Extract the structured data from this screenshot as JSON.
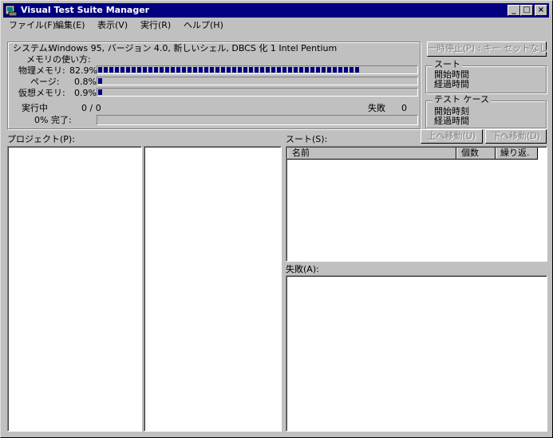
{
  "window": {
    "title": "Visual Test Suite Manager"
  },
  "caption_buttons": {
    "minimize": "_",
    "maximize": "□",
    "close": "×"
  },
  "menu": [
    {
      "label": "ファイル(F)"
    },
    {
      "label": "編集(E)"
    },
    {
      "label": "表示(V)"
    },
    {
      "label": "実行(R)"
    },
    {
      "label": "ヘルプ(H)"
    }
  ],
  "system": {
    "label": "システム:",
    "value": "Windows 95, バージョン 4.0, 新しいシェル, DBCS 化 1 Intel Pentium",
    "memory_label": "メモリの使い方:",
    "physical": {
      "label": "物理メモリ:",
      "value": "82.9%",
      "level": 0.829
    },
    "page": {
      "label": "ページ:",
      "value": "0.8%",
      "level": 0.008
    },
    "virtual": {
      "label": "仮想メモリ:",
      "value": "0.9%",
      "level": 0.009
    },
    "running_label": "実行中",
    "running_value": "0 / 0",
    "failed_label": "失敗",
    "failed_value": "0",
    "percent_value": "0%",
    "complete_label": "完了:",
    "complete_level": 0
  },
  "pause_button": "一時停止(P) : キー セットなし",
  "suite_group": {
    "title": "スート",
    "start": "開始時間",
    "elapsed": "経過時間"
  },
  "testcase_group": {
    "title": "テスト ケース",
    "start": "開始時刻",
    "elapsed": "経過時間"
  },
  "move_up_button": "上へ移動(U)",
  "move_down_button": "下へ移動(D)",
  "project_label": "プロジェクト(P):",
  "suite_label": "スート(S):",
  "suite_columns": [
    "名前",
    "個数",
    "繰り返."
  ],
  "failures_label": "失敗(A):"
}
